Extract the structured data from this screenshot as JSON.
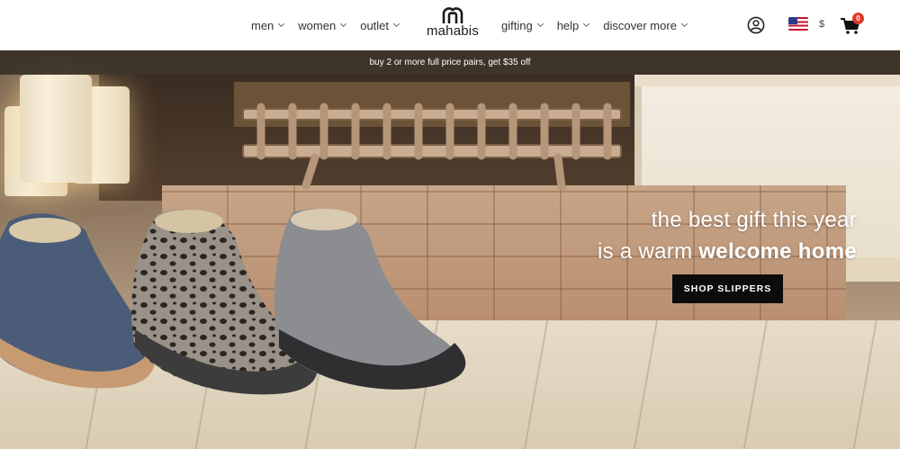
{
  "nav": {
    "left": [
      {
        "label": "men"
      },
      {
        "label": "women"
      },
      {
        "label": "outlet"
      }
    ],
    "right": [
      {
        "label": "gifting"
      },
      {
        "label": "help"
      },
      {
        "label": "discover more"
      }
    ]
  },
  "logo": {
    "text": "mahabis",
    "icon": "mahabis-m-logo-icon"
  },
  "utility": {
    "account_icon": "user-circle-icon",
    "flag_icon": "us-flag-icon",
    "currency": "$",
    "cart_icon": "cart-icon",
    "cart_count": "0"
  },
  "promo": {
    "text": "buy 2 or more full price pairs, get $35 off"
  },
  "hero": {
    "headline_line1": "the best gift this year",
    "headline_line2_prefix": "is a warm ",
    "headline_line2_bold": "welcome home",
    "cta_label": "SHOP SLIPPERS"
  },
  "colors": {
    "badge": "#e0392b",
    "cta_bg": "#0c0c0c",
    "promo_bg": "#2d261e"
  }
}
